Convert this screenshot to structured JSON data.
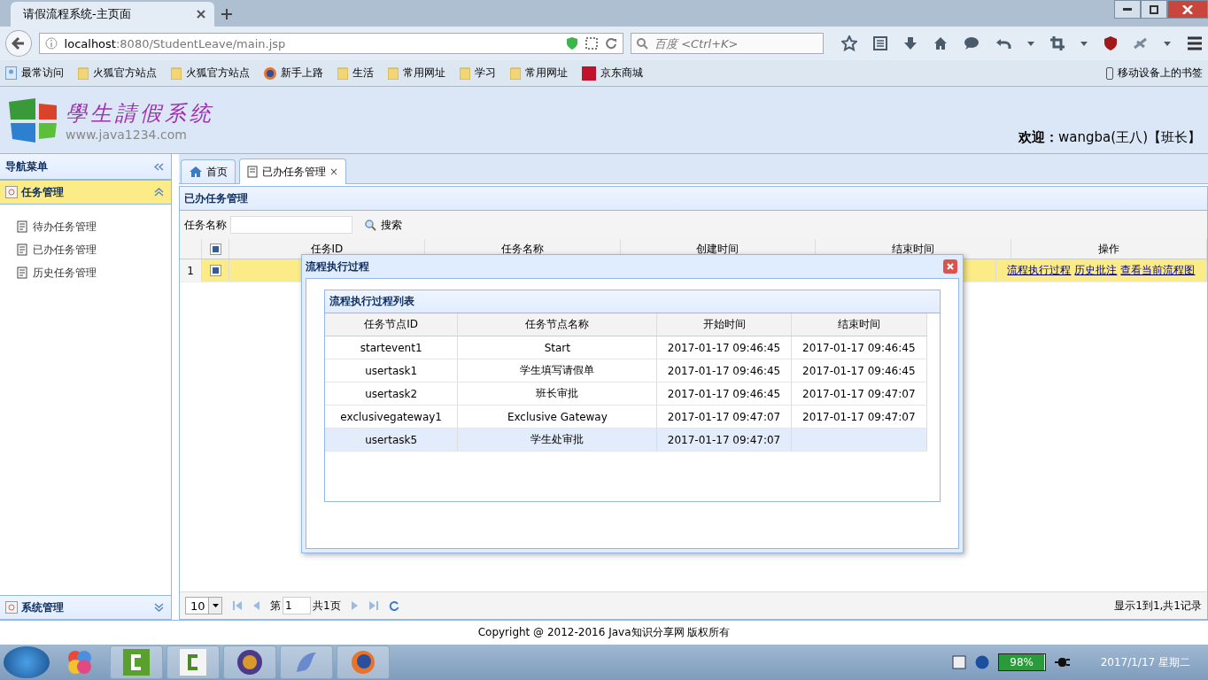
{
  "browser": {
    "tab_title": "请假流程系统-主页面",
    "url_host": "localhost",
    "url_rest": ":8080/StudentLeave/main.jsp",
    "search_placeholder": "百度 <Ctrl+K>",
    "bookmarks": [
      {
        "label": "最常访问",
        "kind": "special"
      },
      {
        "label": "火狐官方站点",
        "kind": "folder"
      },
      {
        "label": "火狐官方站点",
        "kind": "folder"
      },
      {
        "label": "新手上路",
        "kind": "firefox"
      },
      {
        "label": "生活",
        "kind": "folder"
      },
      {
        "label": "常用网址",
        "kind": "folder"
      },
      {
        "label": "学习",
        "kind": "folder"
      },
      {
        "label": "常用网址",
        "kind": "folder"
      },
      {
        "label": "京东商城",
        "kind": "jd"
      }
    ],
    "mobile_bookmarks": "移动设备上的书签"
  },
  "app": {
    "logo_title": "學生請假系统",
    "logo_subtitle": "www.java1234.com",
    "welcome": "**欢迎：**wangba(王八)【班长】"
  },
  "sidebar": {
    "title": "导航菜单",
    "sections": [
      {
        "label": "任务管理",
        "expanded": true,
        "items": [
          "待办任务管理",
          "已办任务管理",
          "历史任务管理"
        ]
      },
      {
        "label": "系统管理",
        "expanded": false
      }
    ]
  },
  "tabs": [
    {
      "label": "首页",
      "selected": false,
      "closable": false
    },
    {
      "label": "已办任务管理",
      "selected": true,
      "closable": true
    }
  ],
  "tab_close": "×",
  "panel": {
    "title": "已办任务管理",
    "search_label": "任务名称",
    "search_button": "搜索",
    "columns": [
      "任务ID",
      "任务名称",
      "创建时间",
      "结束时间",
      "操作"
    ],
    "header_checked": true,
    "rows": [
      {
        "number": "1",
        "checked": true,
        "selected": true,
        "actions": [
          "流程执行过程",
          "历史批注",
          "查看当前流程图"
        ]
      }
    ],
    "pager": {
      "page_size": "10",
      "page_label": "第",
      "page": "1",
      "total": "共1页",
      "summary": "显示1到1,共1记录"
    }
  },
  "dialog": {
    "title": "流程执行过程",
    "list_title": "流程执行过程列表",
    "columns": [
      "任务节点ID",
      "任务节点名称",
      "开始时间",
      "结束时间"
    ],
    "rows": [
      {
        "cells": [
          "startevent1",
          "Start",
          "2017-01-17 09:46:45",
          "2017-01-17 09:46:45"
        ],
        "selected": false
      },
      {
        "cells": [
          "usertask1",
          "学生填写请假单",
          "2017-01-17 09:46:45",
          "2017-01-17 09:46:45"
        ],
        "selected": false
      },
      {
        "cells": [
          "usertask2",
          "班长审批",
          "2017-01-17 09:46:45",
          "2017-01-17 09:47:07"
        ],
        "selected": false
      },
      {
        "cells": [
          "exclusivegateway1",
          "Exclusive Gateway",
          "2017-01-17 09:47:07",
          "2017-01-17 09:47:07"
        ],
        "selected": false
      },
      {
        "cells": [
          "usertask5",
          "学生处审批",
          "2017-01-17 09:47:07",
          ""
        ],
        "selected": true
      }
    ]
  },
  "footer": "Copyright @ 2012-2016 Java知识分享网 版权所有",
  "taskbar": {
    "battery": "98%",
    "level": 0.98,
    "date": "2017/1/17 星期二"
  }
}
